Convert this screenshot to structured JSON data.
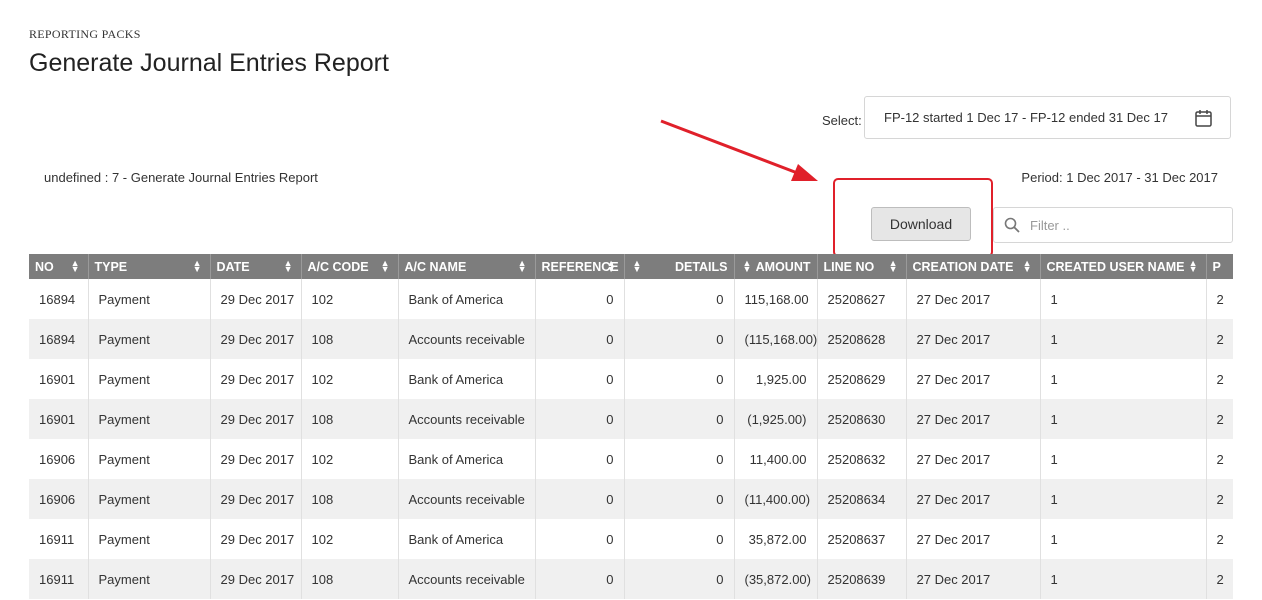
{
  "header": {
    "eyebrow": "REPORTING PACKS",
    "title": "Generate Journal Entries Report"
  },
  "period_select": {
    "label": "Select:",
    "value": "FP-12 started 1 Dec 17 - FP-12 ended 31 Dec 17"
  },
  "report_name": "undefined : 7 - Generate Journal Entries Report",
  "period_text": "Period: 1 Dec 2017 - 31 Dec 2017",
  "download_label": "Download",
  "filter": {
    "placeholder": "Filter .."
  },
  "colors": {
    "header_bg": "#7d7d7d",
    "highlight": "#e0202a",
    "row_alt": "#f0f0f0"
  },
  "table": {
    "columns": [
      "NO",
      "TYPE",
      "DATE",
      "A/C CODE",
      "A/C NAME",
      "REFERENCE",
      "DETAILS",
      "AMOUNT",
      "LINE NO",
      "CREATION DATE",
      "CREATED USER NAME",
      "P"
    ],
    "rows": [
      [
        "16894",
        "Payment",
        "29 Dec 2017",
        "102",
        "Bank of America",
        "0",
        "0",
        "115,168.00",
        "25208627",
        "27 Dec 2017",
        "1",
        "2"
      ],
      [
        "16894",
        "Payment",
        "29 Dec 2017",
        "108",
        "Accounts receivable",
        "0",
        "0",
        "(115,168.00)",
        "25208628",
        "27 Dec 2017",
        "1",
        "2"
      ],
      [
        "16901",
        "Payment",
        "29 Dec 2017",
        "102",
        "Bank of America",
        "0",
        "0",
        "1,925.00",
        "25208629",
        "27 Dec 2017",
        "1",
        "2"
      ],
      [
        "16901",
        "Payment",
        "29 Dec 2017",
        "108",
        "Accounts receivable",
        "0",
        "0",
        "(1,925.00)",
        "25208630",
        "27 Dec 2017",
        "1",
        "2"
      ],
      [
        "16906",
        "Payment",
        "29 Dec 2017",
        "102",
        "Bank of America",
        "0",
        "0",
        "11,400.00",
        "25208632",
        "27 Dec 2017",
        "1",
        "2"
      ],
      [
        "16906",
        "Payment",
        "29 Dec 2017",
        "108",
        "Accounts receivable",
        "0",
        "0",
        "(11,400.00)",
        "25208634",
        "27 Dec 2017",
        "1",
        "2"
      ],
      [
        "16911",
        "Payment",
        "29 Dec 2017",
        "102",
        "Bank of America",
        "0",
        "0",
        "35,872.00",
        "25208637",
        "27 Dec 2017",
        "1",
        "2"
      ],
      [
        "16911",
        "Payment",
        "29 Dec 2017",
        "108",
        "Accounts receivable",
        "0",
        "0",
        "(35,872.00)",
        "25208639",
        "27 Dec 2017",
        "1",
        "2"
      ]
    ]
  }
}
